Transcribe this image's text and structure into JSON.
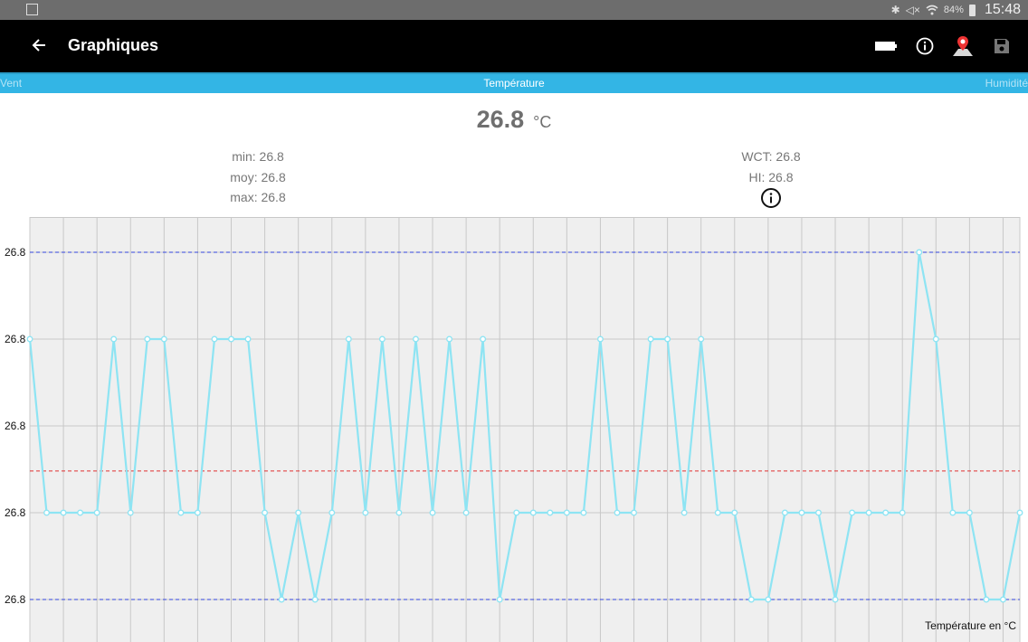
{
  "status_bar": {
    "icons": [
      "gallery-icon",
      "bluetooth-icon",
      "mute-icon",
      "wifi-icon",
      "battery-icon"
    ],
    "battery": "84%",
    "time": "15:48"
  },
  "app_bar": {
    "title": "Graphiques",
    "actions": [
      "battery-icon",
      "info-icon",
      "map-marker-icon",
      "save-icon"
    ]
  },
  "tabs": {
    "left": "Vent",
    "center": "Température",
    "right": "Humidité"
  },
  "current": {
    "value": "26.8",
    "unit": "°C"
  },
  "stats": {
    "min": "min: 26.8",
    "avg": "moy: 26.8",
    "max": "max: 26.8",
    "wct": "WCT: 26.8",
    "hi": "HI: 26.8"
  },
  "chart_caption": "Température en °C",
  "colors": {
    "line": "#8ee4f3",
    "grid_bg": "#efefef",
    "grid_line": "#c8c8c8",
    "max_min_line": "#3344dd",
    "avg_line": "#e03030",
    "tab_bar": "#33b5e5"
  },
  "chart_data": {
    "type": "line",
    "ylabels": [
      "26.8",
      "26.8",
      "26.8",
      "26.8",
      "26.8"
    ],
    "yrange": [
      0,
      4
    ],
    "reference_lines": {
      "max": 4,
      "avg": 1.48,
      "min": 0
    },
    "series": [
      {
        "values": [
          3,
          1,
          1,
          1,
          1,
          3,
          1,
          3,
          3,
          1,
          1,
          3,
          3,
          3,
          1,
          0,
          1,
          0,
          1,
          3,
          1,
          3,
          1,
          3,
          1,
          3,
          1,
          3,
          0,
          1,
          1,
          1,
          1,
          1,
          3,
          1,
          1,
          3,
          3,
          1,
          3,
          1,
          1,
          0,
          0,
          1,
          1,
          1,
          0,
          1,
          1,
          1,
          1,
          4,
          3,
          1,
          1,
          0,
          0,
          1
        ]
      }
    ],
    "grid": true
  }
}
